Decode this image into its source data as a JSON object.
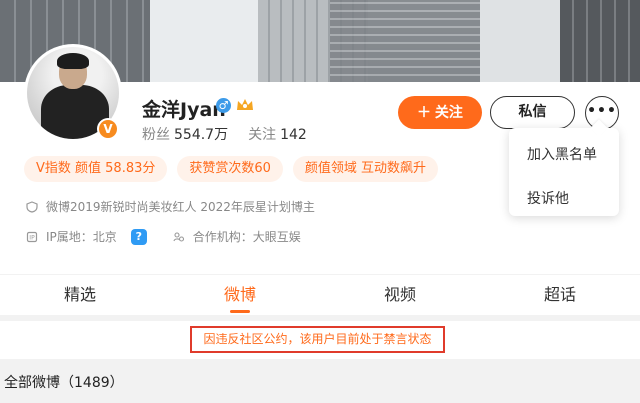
{
  "profile": {
    "name": "金洋Jyan",
    "gender_symbol": "♂",
    "crown_icon": "crown-icon",
    "verified_badge": "V",
    "followers_label": "粉丝",
    "followers_value": "554.7万",
    "following_label": "关注",
    "following_value": "142"
  },
  "actions": {
    "follow_label": "＋ 关注",
    "message_label": "私信",
    "more_label": "•••"
  },
  "menu": {
    "items": [
      "加入黑名单",
      "投诉他"
    ]
  },
  "tags": [
    "V指数 颜值 58.83分",
    "获赞赏次数60",
    "颜值领域 互动数飙升"
  ],
  "info": {
    "description": "微博2019新锐时尚美妆红人 2022年辰星计划博主",
    "ip_label": "IP属地：北京",
    "question_mark": "?",
    "agency_label": "合作机构：大眼互娱"
  },
  "tabs": [
    "精选",
    "微博",
    "视频",
    "超话"
  ],
  "active_tab": "微博",
  "notice": "因违反社区公约，该用户目前处于禁言状态",
  "posts": {
    "all_label": "全部微博（1489）"
  },
  "colors": {
    "accent": "#ff6a1b",
    "notice_border": "#e03b2b",
    "verified_blue": "#2f9bf4"
  }
}
